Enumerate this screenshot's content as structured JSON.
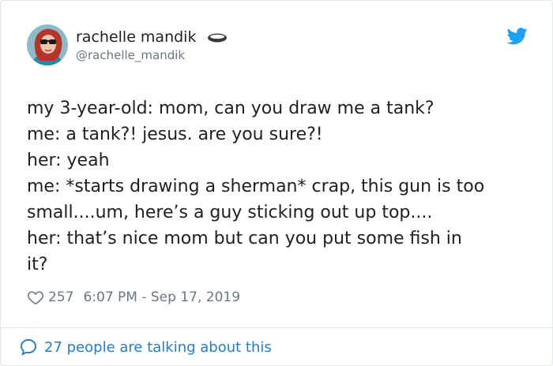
{
  "author": {
    "display_name": "rachelle mandik",
    "handle": "@rachelle_mandik",
    "badge_icon": "bowl-icon",
    "avatar_icon": "avatar"
  },
  "brand": {
    "icon": "twitter-bird-icon",
    "color": "#1da1f2"
  },
  "tweet": {
    "lines": [
      "my 3-year-old: mom, can you draw me a tank?",
      "me: a tank?! jesus. are you sure?!",
      "her: yeah",
      "me: *starts drawing a sherman* crap, this gun is too",
      "small....um, here’s a guy sticking out up top....",
      "her: that’s nice mom but can you put some fish in",
      "it?"
    ]
  },
  "meta": {
    "like_icon": "heart-icon",
    "like_count": "257",
    "timestamp": "6:07 PM - Sep 17, 2019"
  },
  "footer": {
    "icon": "comment-bubble-icon",
    "label": "27 people are talking about this",
    "color": "#2b7bb9"
  }
}
